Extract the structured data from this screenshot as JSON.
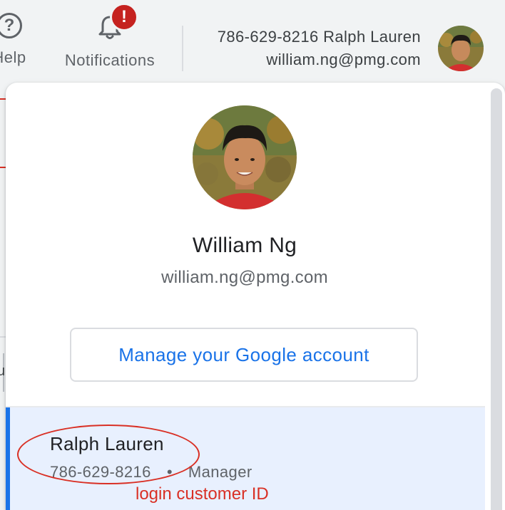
{
  "header": {
    "help_label": "Help",
    "help_icon": "help-circle-icon",
    "notifications_label": "Notifications",
    "notifications_icon": "bell-icon",
    "alert_badge": "!",
    "account_line1": "786-629-8216 Ralph Lauren",
    "account_line2": "william.ng@pmg.com"
  },
  "background": {
    "fragment": "u"
  },
  "popup": {
    "user_name": "William Ng",
    "user_email": "william.ng@pmg.com",
    "manage_button": "Manage your Google account",
    "account": {
      "name": "Ralph Lauren",
      "customer_id": "786-629-8216",
      "separator": "•",
      "role": "Manager"
    },
    "annotation": "login customer ID"
  },
  "colors": {
    "accent_blue": "#1a73e8",
    "alert_red": "#c5221f",
    "annotation_red": "#d93025",
    "selected_row_bg": "#e8f0fe"
  }
}
